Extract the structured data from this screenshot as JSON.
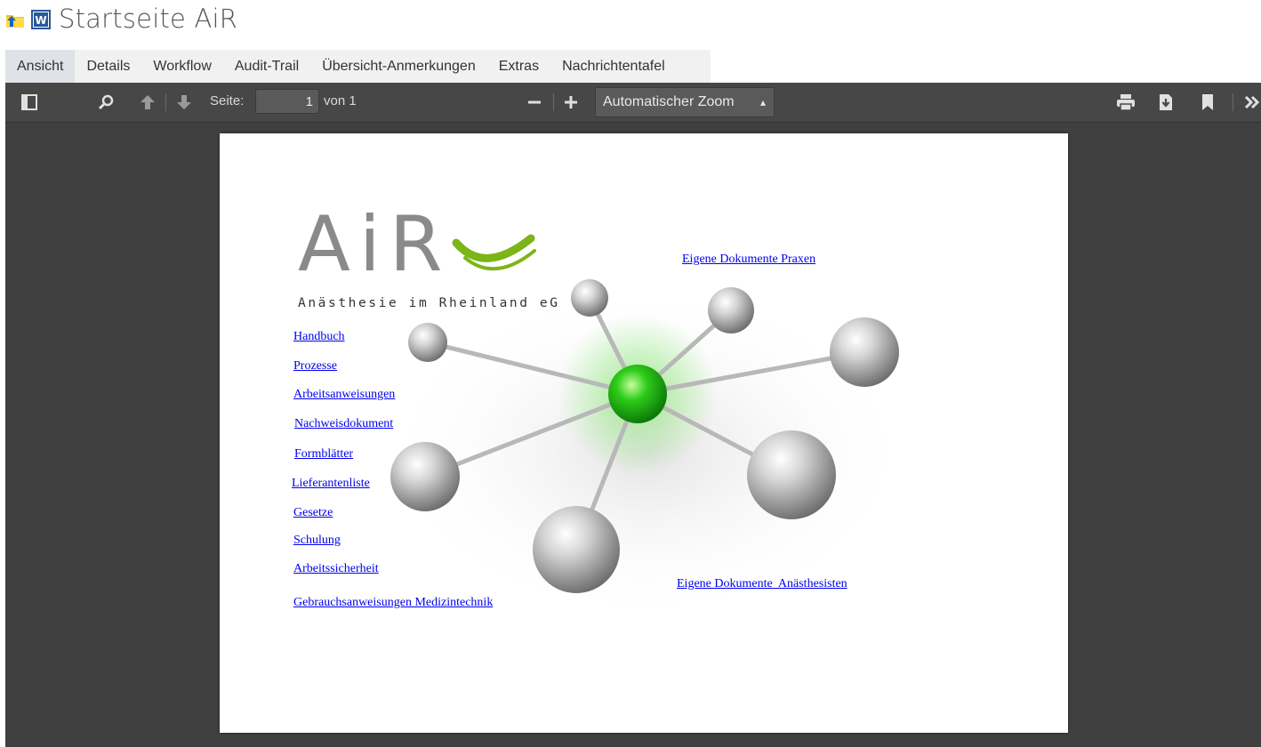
{
  "header": {
    "title": "Startseite AiR",
    "folder_icon": "folder-up-icon",
    "doc_icon": "word-document-icon"
  },
  "tabs": [
    {
      "label": "Ansicht",
      "active": true
    },
    {
      "label": "Details"
    },
    {
      "label": "Workflow"
    },
    {
      "label": "Audit-Trail"
    },
    {
      "label": "Übersicht-Anmerkungen"
    },
    {
      "label": "Extras"
    },
    {
      "label": "Nachrichtentafel"
    }
  ],
  "toolbar": {
    "page_label": "Seite:",
    "page_value": "1",
    "page_total": "von 1",
    "zoom_value": "Automatischer Zoom",
    "icons": [
      "sidebar-toggle-icon",
      "search-icon",
      "previous-page-icon",
      "next-page-icon",
      "zoom-out-icon",
      "zoom-in-icon",
      "print-icon",
      "download-icon",
      "bookmark-icon",
      "more-tools-icon"
    ]
  },
  "document": {
    "logo_text": "AiR",
    "logo_subtitle": "Anästhesie im Rheinland eG",
    "left_links": [
      "Handbuch",
      "Prozesse",
      "Arbeitsanweisungen",
      "Nachweisdokument",
      "Formblätter",
      "Lieferantenliste",
      "Gesetze",
      "Schulung",
      "Arbeitssicherheit",
      "Gebrauchsanweisungen Medizintechnik"
    ],
    "right_links": [
      "Eigene Dokumente Praxen",
      "Eigene Dokumente  Anästhesisten"
    ]
  },
  "colors": {
    "accent_green": "#7cb518",
    "link": "#0000ee",
    "viewer_bg": "#404040"
  }
}
